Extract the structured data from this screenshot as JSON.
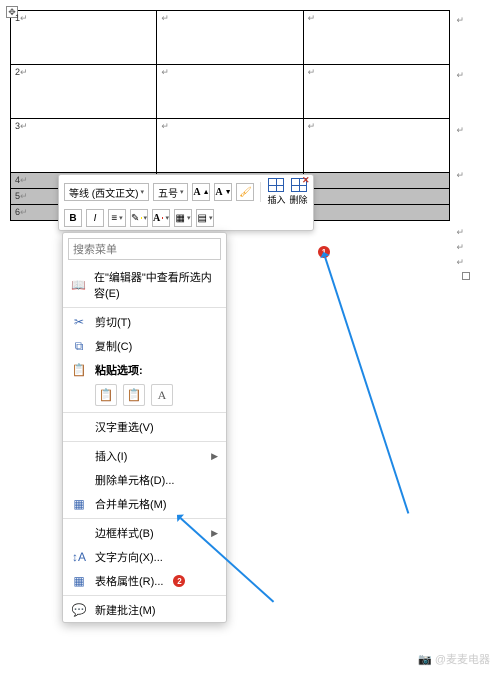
{
  "table": {
    "rows": [
      "1",
      "2",
      "3",
      "4",
      "5",
      "6"
    ]
  },
  "minitoolbar": {
    "font_name": "等线 (西文正文)",
    "font_size": "五号",
    "insert_label": "插入",
    "delete_label": "删除"
  },
  "contextmenu": {
    "search_placeholder": "搜索菜单",
    "look_up": "在\"编辑器\"中查看所选内容(E)",
    "cut": "剪切(T)",
    "copy": "复制(C)",
    "paste_options": "粘贴选项:",
    "reconvert": "汉字重选(V)",
    "insert": "插入(I)",
    "delete_cells": "删除单元格(D)...",
    "merge_cells": "合并单元格(M)",
    "border_styles": "边框样式(B)",
    "text_direction": "文字方向(X)...",
    "table_properties": "表格属性(R)...",
    "new_comment": "新建批注(M)"
  },
  "annotations": {
    "badge1": "1",
    "badge2": "2"
  },
  "watermark": "@麦麦电器"
}
